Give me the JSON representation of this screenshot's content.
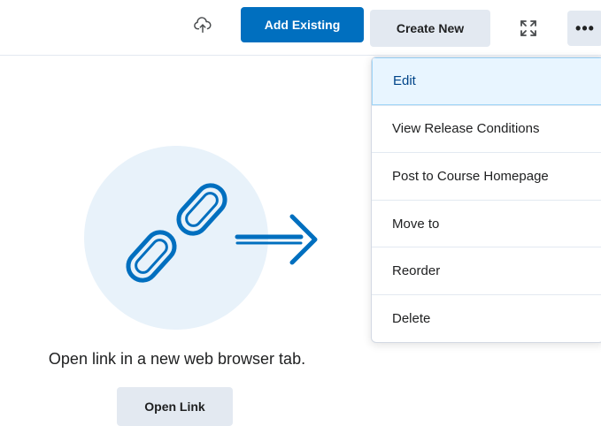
{
  "toolbar": {
    "upload_icon": "cloud-upload-icon",
    "add_existing_label": "Add Existing",
    "create_new_label": "Create New",
    "fullscreen_icon": "fullscreen-expand-icon",
    "more_label": "•••",
    "colors": {
      "primary": "#006fbf",
      "secondary": "#e3e9f1"
    }
  },
  "menu": {
    "items": [
      {
        "label": "Edit",
        "active": true
      },
      {
        "label": "View Release Conditions",
        "active": false
      },
      {
        "label": "Post to Course Homepage",
        "active": false
      },
      {
        "label": "Move to",
        "active": false
      },
      {
        "label": "Reorder",
        "active": false
      },
      {
        "label": "Delete",
        "active": false
      }
    ],
    "colors": {
      "active_bg": "#e8f5ff",
      "active_text": "#004489"
    }
  },
  "main": {
    "illustration_icon": "chain-link-arrow-icon",
    "caption": "Open link in a new web browser tab.",
    "open_link_label": "Open Link",
    "colors": {
      "illustration_bg": "#e8f2fa",
      "illustration_stroke": "#006fbf"
    }
  }
}
